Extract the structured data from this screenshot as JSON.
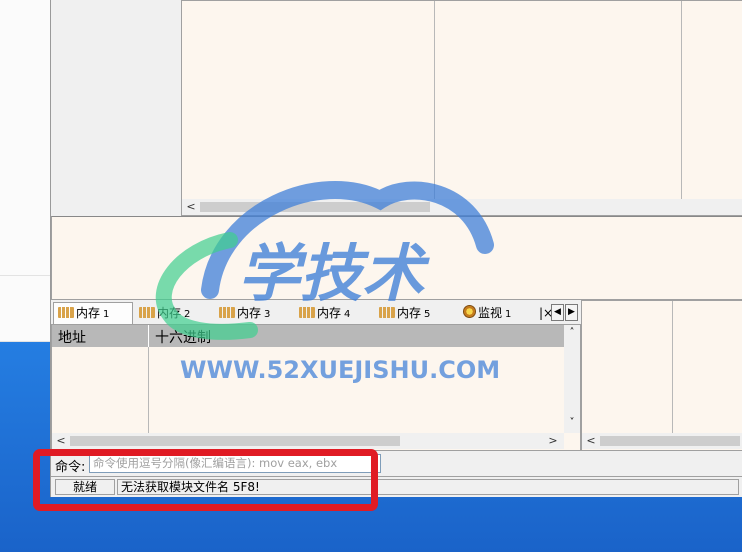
{
  "tabs": [
    {
      "label": "内存",
      "num": "1",
      "icon": "memory-icon"
    },
    {
      "label": "内存",
      "num": "2",
      "icon": "memory-icon"
    },
    {
      "label": "内存",
      "num": "3",
      "icon": "memory-icon"
    },
    {
      "label": "内存",
      "num": "4",
      "icon": "memory-icon"
    },
    {
      "label": "内存",
      "num": "5",
      "icon": "memory-icon"
    },
    {
      "label": "监视",
      "num": "1",
      "icon": "watch-icon"
    },
    {
      "label": "|×",
      "num": "",
      "icon": ""
    }
  ],
  "memory_pane": {
    "col_address": "地址",
    "col_hex": "十六进制"
  },
  "command": {
    "label": "命令:",
    "placeholder": "命令使用逗号分隔(像汇编语言): mov eax, ebx"
  },
  "status": {
    "ready": "就绪",
    "message": "无法获取模块文件名  5F8!"
  },
  "watermark": {
    "title": "学技术",
    "url": "WWW.52XUEJISHU.COM"
  },
  "colors": {
    "pane_bg": "#fdf6ee",
    "highlight_box": "#e01b24",
    "watermark_blue": "#3f7fd8",
    "watermark_green": "#3ecf8e"
  }
}
